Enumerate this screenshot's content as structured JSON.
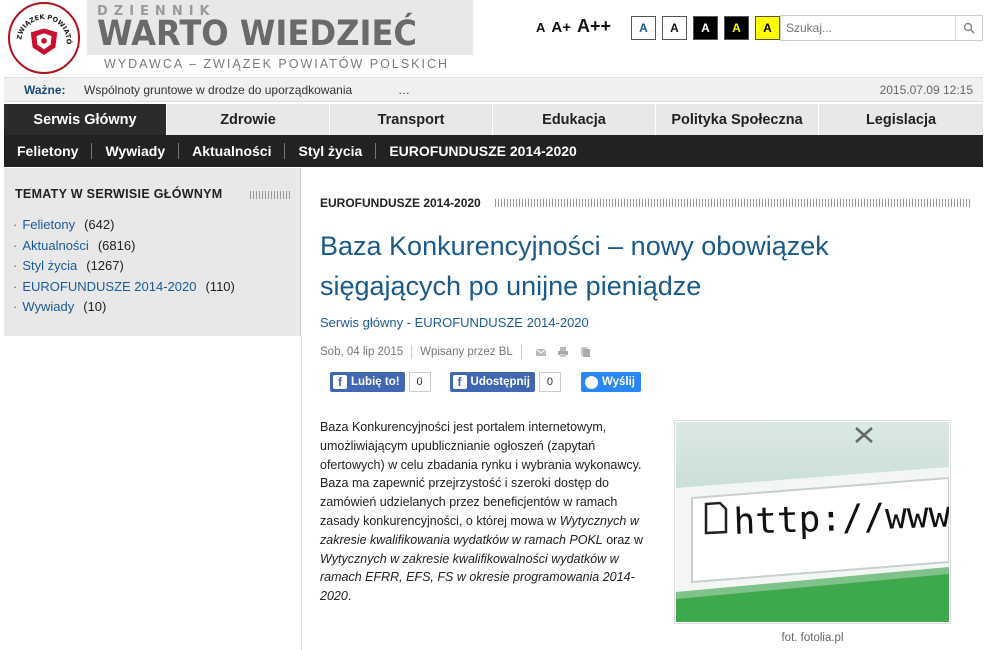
{
  "logo": {
    "text": "ZWIĄZEK POWIATÓW POLSKICH"
  },
  "header": {
    "title_small": "DZIENNIK",
    "title_big": "WARTO WIEDZIEĆ",
    "subtitle": "WYDAWCA – ZWIĄZEK POWIATÓW POLSKICH"
  },
  "accessibility": {
    "font_sizes": [
      "A",
      "A+",
      "A++"
    ],
    "contrast": [
      {
        "label": "A",
        "bg": "#ffffff",
        "fg": "#1a5a9a"
      },
      {
        "label": "A",
        "bg": "#ffffff",
        "fg": "#111111"
      },
      {
        "label": "A",
        "bg": "#000000",
        "fg": "#ffffff"
      },
      {
        "label": "A",
        "bg": "#000000",
        "fg": "#ffff00"
      },
      {
        "label": "A",
        "bg": "#ffff00",
        "fg": "#000000"
      }
    ]
  },
  "search": {
    "placeholder": "Szukaj..."
  },
  "ticker": {
    "label": "Ważne:",
    "text": "Wspólnoty gruntowe w drodze do uporządkowania",
    "more": "…",
    "date": "2015.07.09 12:15"
  },
  "main_nav": [
    {
      "label": "Serwis Główny",
      "active": true
    },
    {
      "label": "Zdrowie",
      "active": false
    },
    {
      "label": "Transport",
      "active": false
    },
    {
      "label": "Edukacja",
      "active": false
    },
    {
      "label": "Polityka Społeczna",
      "active": false
    },
    {
      "label": "Legislacja",
      "active": false
    }
  ],
  "sub_nav": [
    "Felietony",
    "Wywiady",
    "Aktualności",
    "Styl życia",
    "EUROFUNDUSZE 2014-2020"
  ],
  "sidebar": {
    "title": "TEMATY W SERWISIE GŁÓWNYM",
    "items": [
      {
        "label": "Felietony",
        "count": "(642)"
      },
      {
        "label": "Aktualności",
        "count": "(6816)"
      },
      {
        "label": "Styl życia",
        "count": "(1267)"
      },
      {
        "label": "EUROFUNDUSZE 2014-2020",
        "count": "(110)"
      },
      {
        "label": "Wywiady",
        "count": "(10)"
      }
    ]
  },
  "article": {
    "category": "EUROFUNDUSZE 2014-2020",
    "title": "Baza Konkurencyjności – nowy obowiązek sięgających po unijne pieniądze",
    "breadcrumb": "Serwis główny - EUROFUNDUSZE 2014-2020",
    "date": "Sob, 04 lip 2015",
    "author": "Wpisany przez BL",
    "social": {
      "like_label": "Lubię to!",
      "like_count": "0",
      "share_label": "Udostępnij",
      "share_count": "0",
      "send_label": "Wyślij"
    },
    "body_plain": "Baza Konkurencyjności jest portalem internetowym, umożliwiającym upublicznianie ogłoszeń (zapytań ofertowych) w celu zbadania rynku i wybrania wykonawcy. Baza ma zapewnić przejrzystość i szeroki dostęp do zamówień udzielanych przez beneficjentów w ramach zasady konkurencyjności, o której mowa w",
    "body_italic1": "Wytycznych w zakresie kwalifikowania wydatków w ramach POKL",
    "body_mid": "oraz w",
    "body_italic2": "Wytycznych w zakresie  kwalifikowalności wydatków w ramach EFRR, EFS, FS w okresie programowania 2014-2020",
    "body_end": ".",
    "photo_url_text": "http://www.",
    "photo_caption": "fot. fotolia.pl"
  }
}
